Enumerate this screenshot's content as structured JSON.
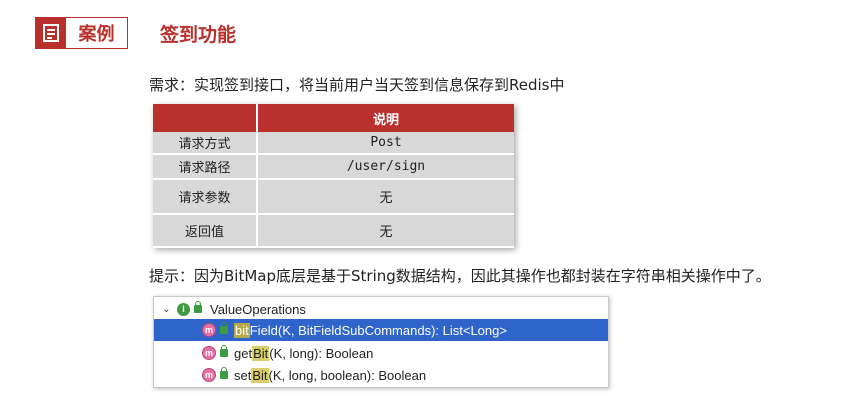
{
  "header": {
    "case_label": "案例",
    "title": "签到功能",
    "accent": "#b9302c"
  },
  "requirement": "需求：实现签到接口，将当前用户当天签到信息保存到Redis中",
  "table": {
    "header": [
      "",
      "说明"
    ],
    "rows": [
      {
        "key": "请求方式",
        "value": "Post"
      },
      {
        "key": "请求路径",
        "value": "/user/sign"
      },
      {
        "key": "请求参数",
        "value": "无"
      },
      {
        "key": "返回值",
        "value": "无"
      }
    ]
  },
  "hint": "提示：因为BitMap底层是基于String数据结构，因此其操作也都封装在字符串相关操作中了。",
  "popup": {
    "class_name": "ValueOperations",
    "methods": [
      {
        "prefix": "bit",
        "rest": "Field(K, BitFieldSubCommands): List<Long>",
        "selected": true
      },
      {
        "before": "get",
        "match": "Bit",
        "rest": "(K, long): Boolean",
        "selected": false
      },
      {
        "before": "set",
        "match": "Bit",
        "rest": "(K, long, boolean): Boolean",
        "selected": false
      }
    ]
  }
}
